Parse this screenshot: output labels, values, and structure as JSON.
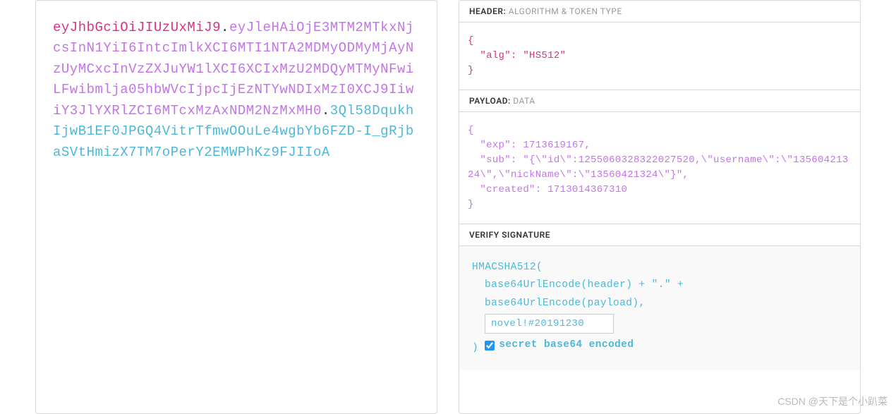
{
  "jwt": {
    "header_part": "eyJhbGciOiJIUzUxMiJ9",
    "payload_part": "eyJleHAiOjE3MTM2MTkxNjcsInN1YiI6IntcImlkXCI6MTI1NTA2MDMyODMyMjAyNzUyMCxcInVzZXJuYW1lXCI6XCIxMzU2MDQyMTMyNFwiLFwibmlja05hbWVcIjpcIjEzNTYwNDIxMzI0XCJ9IiwiY3JlYXRlZCI6MTcxMzAxNDM2NzMxMH0",
    "signature_part": "3Ql58DqukhIjwB1EF0JPGQ4VitrTfmwOOuLe4wgbYb6FZD-I_gRjbaSVtHmizX7TM7oPerY2EMWPhKz9FJIIoA",
    "dot": "."
  },
  "sections": {
    "header_label": "HEADER:",
    "header_desc": "ALGORITHM & TOKEN TYPE",
    "payload_label": "PAYLOAD:",
    "payload_desc": "DATA",
    "verify_label": "VERIFY SIGNATURE"
  },
  "header_json": "{\n  \"alg\": \"HS512\"\n}",
  "payload_json": "{\n  \"exp\": 1713619167,\n  \"sub\": \"{\\\"id\\\":1255060328322027520,\\\"username\\\":\\\"13560421324\\\",\\\"nickName\\\":\\\"13560421324\\\"}\",\n  \"created\": 1713014367310\n}",
  "signature": {
    "line1": "HMACSHA512(",
    "line2": "base64UrlEncode(header) + \".\" +",
    "line3": "base64UrlEncode(payload),",
    "secret_value": "novel!#20191230",
    "close": ")",
    "checkbox_label": "secret base64 encoded",
    "checkbox_checked": true
  },
  "watermark": "CSDN @天下是个小趴菜"
}
